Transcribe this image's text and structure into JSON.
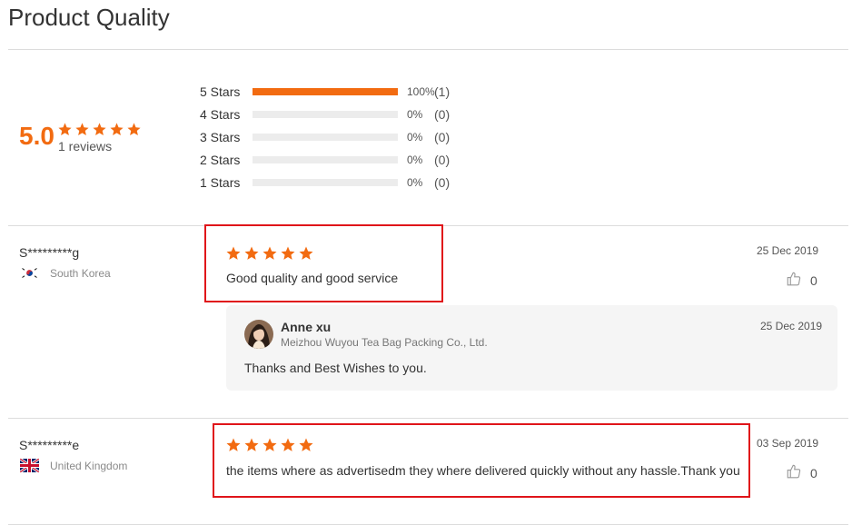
{
  "section_title": "Product Quality",
  "summary": {
    "score": "5.0",
    "stars_filled": 5,
    "reviews_label": "1 reviews",
    "distribution": [
      {
        "label": "5 Stars",
        "fraction": 1.0,
        "percent": "100%",
        "count": "(1)"
      },
      {
        "label": "4 Stars",
        "fraction": 0.0,
        "percent": "0%",
        "count": "(0)"
      },
      {
        "label": "3 Stars",
        "fraction": 0.0,
        "percent": "0%",
        "count": "(0)"
      },
      {
        "label": "2 Stars",
        "fraction": 0.0,
        "percent": "0%",
        "count": "(0)"
      },
      {
        "label": "1 Stars",
        "fraction": 0.0,
        "percent": "0%",
        "count": "(0)"
      }
    ]
  },
  "reviews": [
    {
      "name": "S*********g",
      "country": "South Korea",
      "flag_icon": "south-korea-flag-icon",
      "rating": 5,
      "text": "Good quality and good service",
      "date": "25 Dec 2019",
      "likes": "0",
      "reply": {
        "name": "Anne xu",
        "company": "Meizhou Wuyou Tea Bag Packing Co., Ltd.",
        "date": "25 Dec 2019",
        "text": "Thanks and Best Wishes to you."
      }
    },
    {
      "name": "S*********e",
      "country": "United Kingdom",
      "flag_icon": "uk-flag-icon",
      "rating": 5,
      "text": "the items where as advertisedm they where delivered quickly without any hassle.Thank you",
      "date": "03 Sep 2019",
      "likes": "0"
    }
  ],
  "colors": {
    "accent": "#f26b11",
    "highlight_box": "#e0151a",
    "bar_empty": "#ececec",
    "reply_bg": "#f5f5f5"
  }
}
